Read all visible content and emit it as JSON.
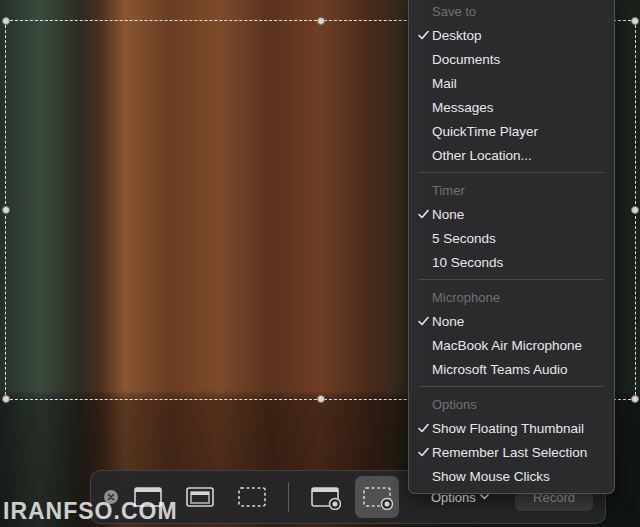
{
  "menu": {
    "sections": [
      {
        "header": "Save to",
        "items": [
          {
            "label": "Desktop",
            "checked": true
          },
          {
            "label": "Documents",
            "checked": false
          },
          {
            "label": "Mail",
            "checked": false
          },
          {
            "label": "Messages",
            "checked": false
          },
          {
            "label": "QuickTime Player",
            "checked": false
          },
          {
            "label": "Other Location...",
            "checked": false
          }
        ]
      },
      {
        "header": "Timer",
        "items": [
          {
            "label": "None",
            "checked": true
          },
          {
            "label": "5 Seconds",
            "checked": false
          },
          {
            "label": "10 Seconds",
            "checked": false
          }
        ]
      },
      {
        "header": "Microphone",
        "items": [
          {
            "label": "None",
            "checked": true
          },
          {
            "label": "MacBook Air Microphone",
            "checked": false
          },
          {
            "label": "Microsoft Teams Audio",
            "checked": false
          }
        ]
      },
      {
        "header": "Options",
        "items": [
          {
            "label": "Show Floating Thumbnail",
            "checked": true
          },
          {
            "label": "Remember Last Selection",
            "checked": true
          },
          {
            "label": "Show Mouse Clicks",
            "checked": false
          }
        ]
      }
    ]
  },
  "toolbar": {
    "tools": [
      {
        "kind": "screen",
        "group": "capture",
        "selected": false
      },
      {
        "kind": "window",
        "group": "capture",
        "selected": false
      },
      {
        "kind": "selection",
        "group": "capture",
        "selected": false
      },
      {
        "kind": "record-screen",
        "group": "record",
        "selected": false
      },
      {
        "kind": "record-selection",
        "group": "record",
        "selected": true
      }
    ],
    "options_button": {
      "label": "Options"
    },
    "record_button": {
      "label": "Record"
    }
  },
  "watermark": "IRANFSO.COM"
}
